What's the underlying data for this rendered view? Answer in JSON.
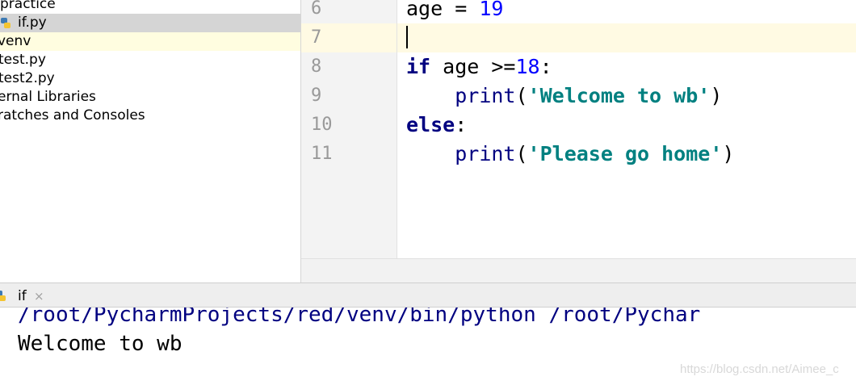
{
  "project_tree": {
    "items": [
      {
        "label": "practice"
      },
      {
        "label": "if.py"
      },
      {
        "label": "venv"
      },
      {
        "label": "test.py"
      },
      {
        "label": "test2.py"
      },
      {
        "label": "ernal Libraries"
      },
      {
        "label": "ratches and Consoles"
      }
    ]
  },
  "editor": {
    "lines": [
      {
        "num": "6",
        "tokens": [
          {
            "t": "age = ",
            "c": ""
          },
          {
            "t": "19",
            "c": "num"
          }
        ]
      },
      {
        "num": "7",
        "tokens": []
      },
      {
        "num": "8",
        "tokens": [
          {
            "t": "if",
            "c": "kw"
          },
          {
            "t": " age >=",
            "c": ""
          },
          {
            "t": "18",
            "c": "num"
          },
          {
            "t": ":",
            "c": ""
          }
        ]
      },
      {
        "num": "9",
        "tokens": [
          {
            "t": "    ",
            "c": ""
          },
          {
            "t": "print",
            "c": "fn"
          },
          {
            "t": "(",
            "c": ""
          },
          {
            "t": "'Welcome to wb'",
            "c": "str"
          },
          {
            "t": ")",
            "c": ""
          }
        ]
      },
      {
        "num": "10",
        "tokens": [
          {
            "t": "else",
            "c": "kw"
          },
          {
            "t": ":",
            "c": ""
          }
        ]
      },
      {
        "num": "11",
        "tokens": [
          {
            "t": "    ",
            "c": ""
          },
          {
            "t": "print",
            "c": "fn"
          },
          {
            "t": "(",
            "c": ""
          },
          {
            "t": "'Please go home'",
            "c": "str"
          },
          {
            "t": ")",
            "c": ""
          }
        ]
      }
    ]
  },
  "run_panel": {
    "tab_label": "if",
    "tab_close": "×",
    "console": {
      "command": "/root/PycharmProjects/red/venv/bin/python /root/Pychar",
      "output": "Welcome to wb"
    }
  },
  "watermark": "https://blog.csdn.net/Aimee_c",
  "colors": {
    "keyword": "#000080",
    "number": "#0000ff",
    "string": "#008080",
    "current_line": "#fffae3",
    "selection": "#d5d5d5"
  }
}
